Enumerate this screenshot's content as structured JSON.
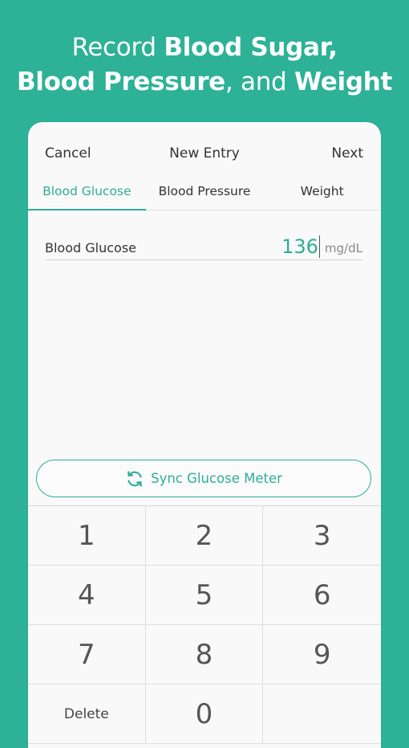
{
  "promo": {
    "line1_light": "Record ",
    "line1_bold": "Blood Sugar,",
    "line2_bold_a": "Blood Pressure",
    "line2_light": ", and ",
    "line2_bold_b": "Weight"
  },
  "navbar": {
    "cancel_label": "Cancel",
    "title": "New Entry",
    "next_label": "Next"
  },
  "tabs": [
    {
      "label": "Blood Glucose",
      "active": true
    },
    {
      "label": "Blood Pressure",
      "active": false
    },
    {
      "label": "Weight",
      "active": false
    }
  ],
  "entry": {
    "label": "Blood Glucose",
    "value": "136",
    "unit": "mg/dL"
  },
  "sync": {
    "label": "Sync Glucose Meter",
    "icon": "sync-icon"
  },
  "keypad": {
    "keys": [
      "1",
      "2",
      "3",
      "4",
      "5",
      "6",
      "7",
      "8",
      "9",
      "Delete",
      "0",
      ""
    ]
  },
  "colors": {
    "background": "#2db197",
    "accent": "#2fae96",
    "card": "#f9f9f9"
  }
}
